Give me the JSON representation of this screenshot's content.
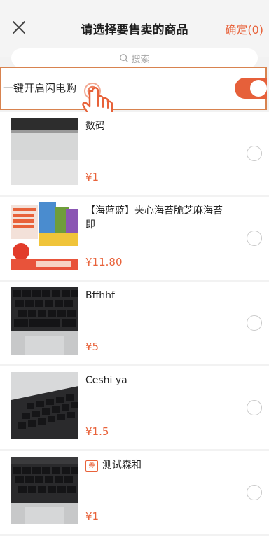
{
  "header": {
    "title": "请选择要售卖的商品",
    "confirm_label": "确定(0)"
  },
  "search": {
    "placeholder": "搜索"
  },
  "flash": {
    "label": "一键开启闪电购",
    "toggle_on": true
  },
  "products": [
    {
      "name": "数码",
      "price": "¥1",
      "image": "laptop-photo",
      "has_tag": false
    },
    {
      "name": "【海蓝蓝】夹心海苔脆芝麻海苔即",
      "price": "¥11.80",
      "image": "seaweed-snack-package",
      "has_tag": false
    },
    {
      "name": "Bffhhf",
      "price": "¥5",
      "image": "keyboard-photo",
      "has_tag": false
    },
    {
      "name": "Ceshi ya",
      "price": "¥1.5",
      "image": "laptop-keyboard-photo",
      "has_tag": false
    },
    {
      "name": "测试森和",
      "price": "¥1",
      "image": "keyboard-photo",
      "has_tag": true,
      "tag_label": "券"
    }
  ],
  "colors": {
    "accent": "#e8623a",
    "background": "#f2f2f2"
  }
}
